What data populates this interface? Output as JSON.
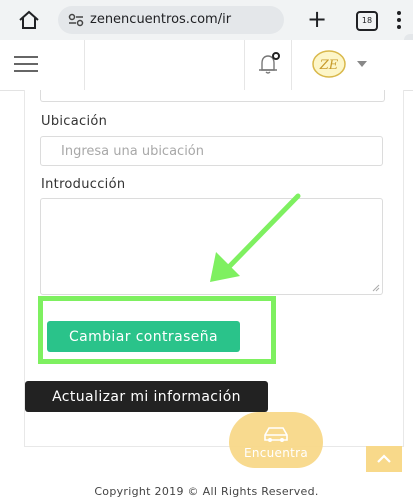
{
  "browser": {
    "url": "zenencuentros.com/ir",
    "tab_count": "18"
  },
  "navbar": {
    "logo_text": "ZE"
  },
  "form": {
    "location_label": "Ubicación",
    "location_placeholder": "Ingresa una ubicación",
    "intro_label": "Introducción",
    "change_password_button": "Cambiar contraseña",
    "update_button": "Actualizar mi información"
  },
  "floating": {
    "encuentra_label": "Encuentra"
  },
  "footer": {
    "copyright": "Copyright 2019 © All Rights Reserved."
  },
  "colors": {
    "accent_green": "#2ac38a",
    "highlight_green": "#7ef060",
    "dark_button": "#222222",
    "badge_yellow": "#f8d98a"
  }
}
